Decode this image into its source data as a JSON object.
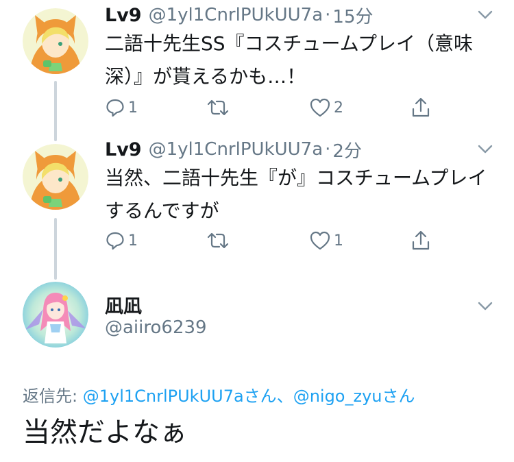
{
  "thread": [
    {
      "name": "Lv9",
      "handle": "@1yl1CnrlPUkUU7a",
      "separator": "·",
      "time": "15分",
      "text": "二語十先生SS『コスチュームプレイ（意味\n深）』が貰えるかも…！",
      "replies": "1",
      "retweets": "",
      "likes": "2",
      "avatar_icon": "hooded-character-avatar"
    },
    {
      "name": "Lv9",
      "handle": "@1yl1CnrlPUkUU7a",
      "separator": "·",
      "time": "2分",
      "text": "当然、二語十先生『が』コスチュームプレイ\nするんですが",
      "replies": "1",
      "retweets": "",
      "likes": "1",
      "avatar_icon": "hooded-character-avatar"
    }
  ],
  "focused": {
    "name": "凪凪",
    "handle": "@aiiro6239",
    "replying_prefix": "返信先: ",
    "mention1": "@1yl1CnrlPUkUU7aさん",
    "mention_sep": "、",
    "mention2": "@nigo_zyuさん",
    "text": "当然だよなぁ",
    "avatar_icon": "pink-hair-character-avatar"
  },
  "colors": {
    "text": "#14171a",
    "secondary": "#657786",
    "link": "#1da1f2",
    "thread_line": "#cdd5dc"
  }
}
